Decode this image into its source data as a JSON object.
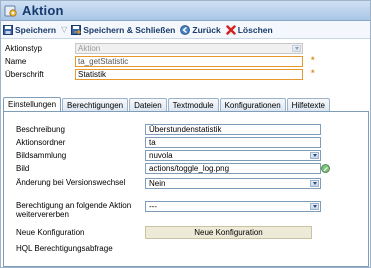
{
  "window": {
    "title": "Aktion"
  },
  "toolbar": {
    "save_label": "Speichern",
    "save_close_label": "Speichern & Schließen",
    "back_label": "Zurück",
    "delete_label": "Löschen"
  },
  "form": {
    "type_label": "Aktionstyp",
    "type_value": "Aktion",
    "name_label": "Name",
    "name_value": "ta_getStatistic",
    "heading_label": "Überschrift",
    "heading_value": "Statistik",
    "required_marker": "*"
  },
  "tabs": [
    {
      "label": "Einstellungen",
      "active": true
    },
    {
      "label": "Berechtigungen",
      "active": false
    },
    {
      "label": "Dateien",
      "active": false
    },
    {
      "label": "Textmodule",
      "active": false
    },
    {
      "label": "Konfigurationen",
      "active": false
    },
    {
      "label": "Hilfetexte",
      "active": false
    }
  ],
  "settings": {
    "description_label": "Beschreibung",
    "description_value": "Überstundenstatistik",
    "folder_label": "Aktionsordner",
    "folder_value": "ta",
    "imageset_label": "Bildsammlung",
    "imageset_value": "nuvola",
    "image_label": "Bild",
    "image_value": "actions/toggle_log.png",
    "version_change_label": "Änderung bei Versionswechsel",
    "version_change_value": "Nein",
    "inherit_perm_label": "Berechtigung an folgende Aktion weitervererben",
    "inherit_perm_value": "---",
    "new_config_label": "Neue Konfiguration",
    "new_config_button": "Neue Konfiguration",
    "hql_label": "HQL Berechtigungsabfrage"
  }
}
